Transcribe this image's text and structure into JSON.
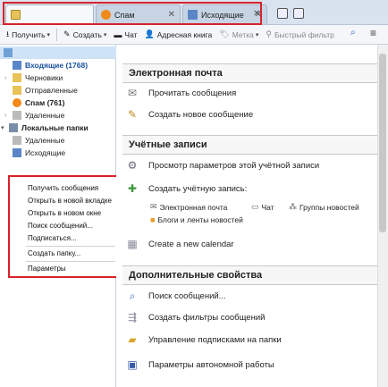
{
  "tabs": [
    {
      "label": ""
    },
    {
      "label": "Спам"
    },
    {
      "label": "Исходящие"
    }
  ],
  "toolbar": {
    "get_label": "Получить",
    "create_label": "Создать",
    "chat_label": "Чат",
    "addressbook_label": "Адресная книга",
    "tag_label": "Метка",
    "filter_label": "Быстрый фильтр"
  },
  "folders": {
    "account_name": "",
    "inbox": "Входящие (1768)",
    "drafts": "Черновики",
    "sent": "Отправленные",
    "spam": "Спам (761)",
    "trash": "Удаленные",
    "local_folders": "Локальные папки",
    "local_trash": "Удаленные",
    "local_outbox": "Исходящие"
  },
  "context_menu": {
    "items": [
      "Получить сообщения",
      "Открыть в новой вкладке",
      "Открыть в новом окне",
      "Поиск сообщений...",
      "Подписаться...",
      "Создать папку...",
      "Параметры"
    ]
  },
  "main": {
    "email_header": "Электронная почта",
    "read_messages": "Прочитать сообщения",
    "compose": "Создать новое сообщение",
    "accounts_header": "Учётные записи",
    "view_account_settings": "Просмотр параметров этой учётной записи",
    "create_account": "Создать учётную запись:",
    "sub_email": "Электронная почта",
    "sub_chat": "Чат",
    "sub_newsgroups": "Группы новостей",
    "sub_blogs": "Блоги и ленты новостей",
    "create_calendar": "Create a new calendar",
    "advanced_header": "Дополнительные свойства",
    "search_messages": "Поиск сообщений...",
    "create_filters": "Создать фильтры сообщений",
    "manage_subscriptions": "Управление подписками на папки",
    "offline_settings": "Параметры автономной работы"
  },
  "colors": {
    "highlight_border": "#d8222b",
    "selected_folder": "#cfe3f7",
    "inbox_text": "#1a52a0"
  }
}
